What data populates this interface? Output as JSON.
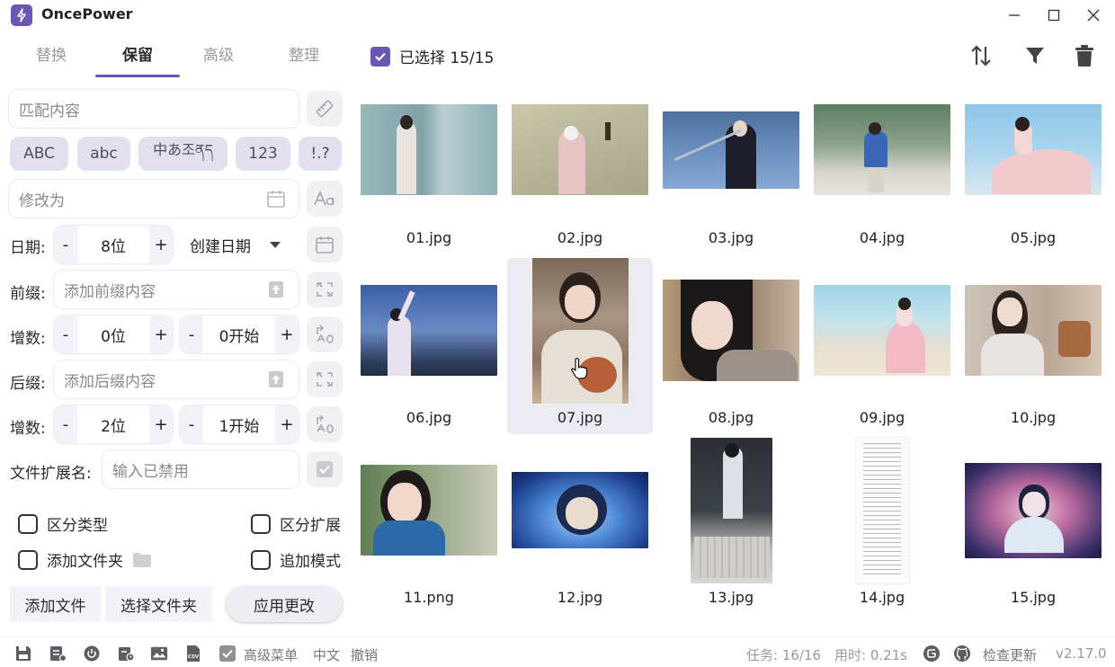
{
  "app": {
    "title": "OncePower",
    "version": "v2.17.0"
  },
  "tabs": [
    {
      "label": "替换",
      "active": false
    },
    {
      "label": "保留",
      "active": true
    },
    {
      "label": "高级",
      "active": false
    },
    {
      "label": "整理",
      "active": false
    }
  ],
  "match": {
    "placeholder": "匹配内容"
  },
  "chips": [
    "ABC",
    "abc",
    "中あ조ནད",
    "123",
    "!.?"
  ],
  "modify": {
    "placeholder": "修改为"
  },
  "date": {
    "label": "日期:",
    "digits": "8位",
    "type": "创建日期"
  },
  "prefix": {
    "label": "前缀:",
    "placeholder": "添加前缀内容"
  },
  "prefix_increment": {
    "label": "增数:",
    "digits": "0位",
    "start": "0开始"
  },
  "suffix": {
    "label": "后缀:",
    "placeholder": "添加后缀内容"
  },
  "suffix_increment": {
    "label": "增数:",
    "digits": "2位",
    "start": "1开始"
  },
  "extension": {
    "label": "文件扩展名:",
    "placeholder": "输入已禁用"
  },
  "options": {
    "distinguish_type": "区分类型",
    "distinguish_ext": "区分扩展",
    "add_folder": "添加文件夹",
    "append_mode": "追加模式"
  },
  "buttons": {
    "add_files": "添加文件",
    "select_folder": "选择文件夹",
    "apply": "应用更改",
    "minus": "-",
    "plus": "+"
  },
  "selection": {
    "label": "已选择 15/15",
    "checked": true
  },
  "files": [
    {
      "name": "01.jpg"
    },
    {
      "name": "02.jpg"
    },
    {
      "name": "03.jpg"
    },
    {
      "name": "04.jpg"
    },
    {
      "name": "05.jpg"
    },
    {
      "name": "06.jpg"
    },
    {
      "name": "07.jpg"
    },
    {
      "name": "08.jpg"
    },
    {
      "name": "09.jpg"
    },
    {
      "name": "10.jpg"
    },
    {
      "name": "11.png"
    },
    {
      "name": "12.jpg"
    },
    {
      "name": "13.jpg"
    },
    {
      "name": "14.jpg"
    },
    {
      "name": "15.jpg"
    }
  ],
  "statusbar": {
    "advanced_menu": "高级菜单",
    "language": "中文",
    "undo": "撤销",
    "tasks": "任务: 16/16",
    "elapsed": "用时: 0.21s",
    "check_update": "检查更新"
  },
  "colors": {
    "accent": "#6b55b5",
    "chip_bg": "#e4dfef"
  }
}
